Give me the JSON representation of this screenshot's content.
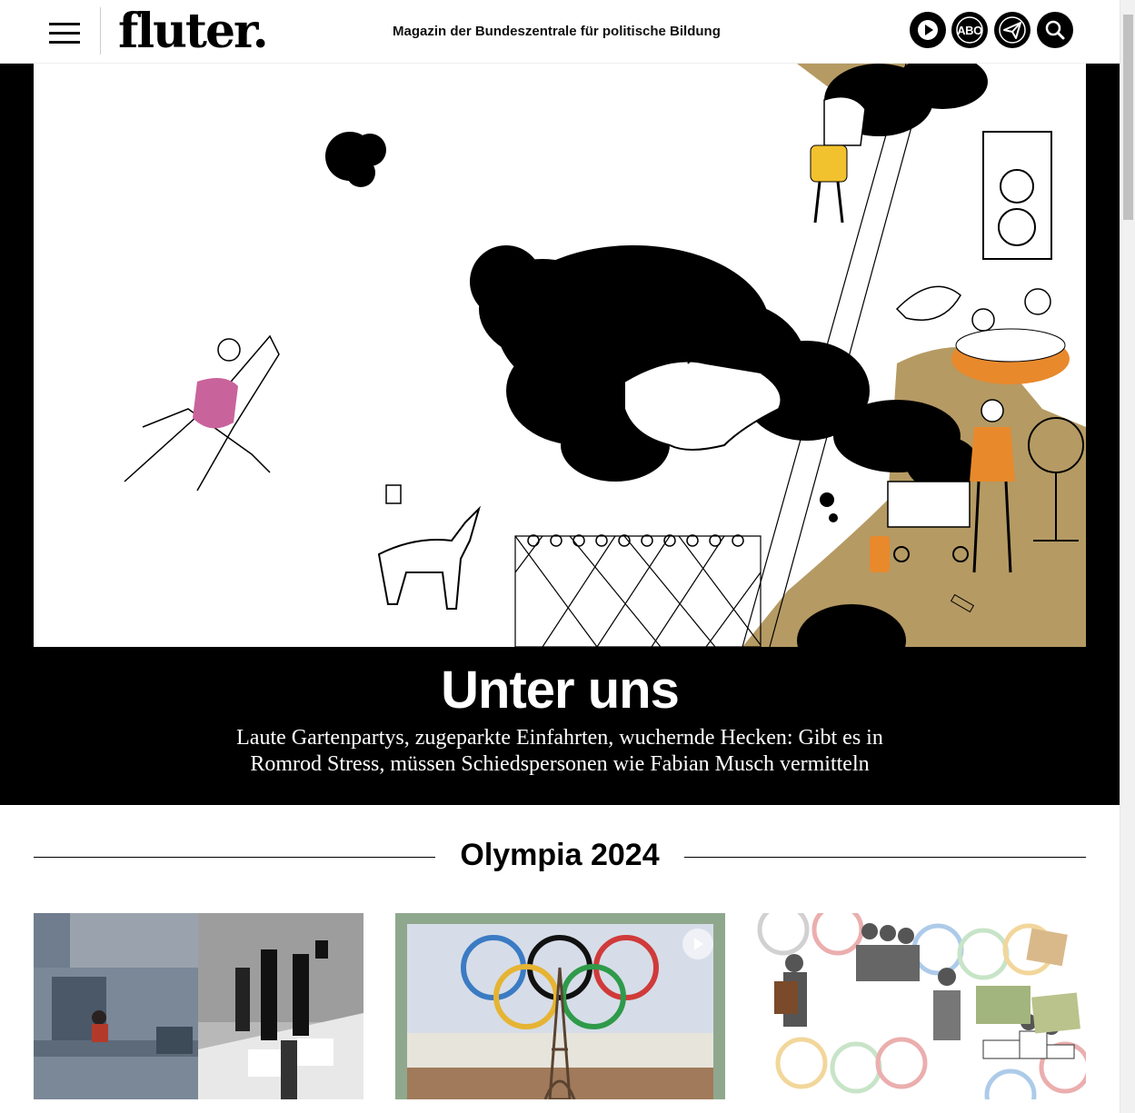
{
  "header": {
    "logo": "fluter.",
    "tagline": "Magazin der Bundeszentrale für politische Bildung",
    "buttons": {
      "play_icon": "play-icon",
      "abo_label": "ABO",
      "telegram_icon": "send-icon",
      "search_icon": "search-icon"
    }
  },
  "hero": {
    "title": "Unter uns",
    "subtitle": "Laute Gartenpartys, zugeparkte Einfahrten, wuchernde Hecken: Gibt es in Romrod Stress, müssen Schiedspersonen wie Fabian Musch vermitteln"
  },
  "section": {
    "title": "Olympia 2024"
  },
  "colors": {
    "black": "#000000",
    "pink": "#c9639c",
    "yellow": "#f2c12e",
    "orange": "#e8892c",
    "tan": "#b59a63",
    "card_green": "#8fa88d"
  }
}
